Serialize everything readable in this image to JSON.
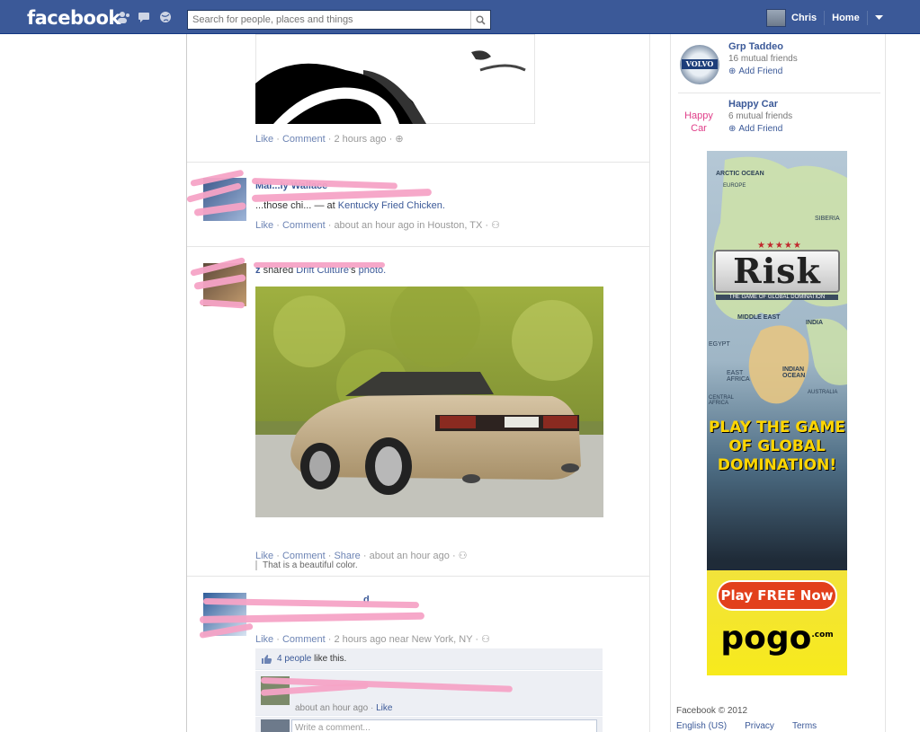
{
  "header": {
    "logo": "facebook",
    "search_placeholder": "Search for people, places and things",
    "user_name": "Chris",
    "home": "Home"
  },
  "feed": {
    "story1": {
      "actions": [
        "Like",
        "Comment",
        "2 hours ago"
      ]
    },
    "story2": {
      "actor": "Mai...ly Wallace",
      "text_prefix": "...those chi...",
      "text_at": "— at",
      "place": "Kentucky Fried Chicken.",
      "actions": [
        "Like",
        "Comment",
        "about an hour ago in Houston, TX"
      ]
    },
    "story3": {
      "actor_suffix": "z",
      "shared": "shared",
      "page": "Drift Culture",
      "apostrophe": "'s",
      "photo": "photo.",
      "caption": "That is a beautiful color.",
      "actions": [
        "Like",
        "Comment",
        "Share",
        "about an hour ago"
      ]
    },
    "story4": {
      "actor_suffix": "d",
      "actions": [
        "Like",
        "Comment",
        "2 hours ago near New York, NY"
      ],
      "likes_count": "4 people",
      "likes_suffix": " like this.",
      "comment_time": "about an hour ago",
      "comment_like": "Like",
      "comment_placeholder": "Write a comment..."
    }
  },
  "sidebar": {
    "suggestions": [
      {
        "name": "Grp Taddeo",
        "mutual": "16 mutual friends",
        "add": "Add Friend",
        "logo": "VOLVO"
      },
      {
        "name": "Happy Car",
        "mutual": "6 mutual friends",
        "add": "Add Friend",
        "logo_line1": "Happy",
        "logo_line2": "Car"
      }
    ],
    "ad": {
      "title": "Risk",
      "subtitle": "THE GAME OF GLOBAL DOMINATION",
      "tagline": "PLAY THE GAME OF GLOBAL DOMINATION!",
      "button": "Play FREE Now",
      "brand": "pogo",
      "brand_suffix": ".com",
      "map_labels": [
        "ARCTIC OCEAN",
        "EUROPE",
        "SIBERIA",
        "MIDDLE EAST",
        "INDIA",
        "EGYPT",
        "EAST AFRICA",
        "INDIAN OCEAN",
        "CENTRAL AFRICA",
        "AUSTRALIA"
      ]
    },
    "footer": {
      "copyright": "Facebook © 2012",
      "links": [
        "English (US)",
        "Privacy",
        "Terms"
      ]
    }
  },
  "colors": {
    "brand": "#3b5998",
    "link": "#3b5998",
    "ad_yellow": "#f7ea1c",
    "scribble": "#f5a3c6"
  }
}
